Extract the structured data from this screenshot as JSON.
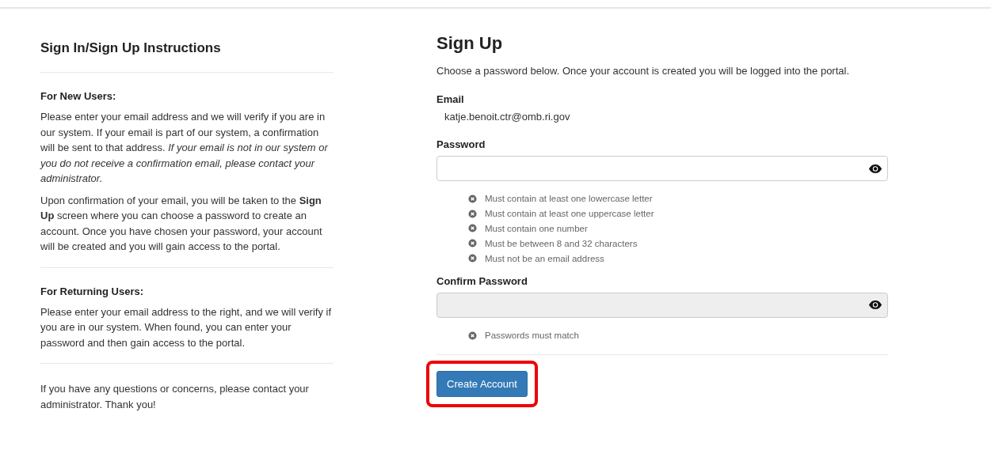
{
  "instructions": {
    "title": "Sign In/Sign Up Instructions",
    "sections": [
      {
        "heading": "For New Users:",
        "paragraphs": [
          "Please enter your email address and we will verify if you are in our system. If your email is part of our system, a confirmation will be sent to that address. *If your email is not in our system or you do not receive a confirmation email, please contact your administrator.*",
          "Upon confirmation of your email, you will be taken to the **Sign Up** screen where you can choose a password to create an account. Once you have chosen your password, your account will be created and you will gain access to the portal."
        ]
      },
      {
        "heading": "For Returning Users:",
        "paragraphs": [
          "Please enter your email address to the right, and we will verify if you are in our system. When found, you can enter your password and then gain access to the portal."
        ]
      },
      {
        "paragraphs": [
          "If you have any questions or concerns, please contact your administrator. Thank you!"
        ]
      }
    ]
  },
  "signup": {
    "title": "Sign Up",
    "intro": "Choose a password below. Once your account is created you will be logged into the portal.",
    "email": {
      "label": "Email",
      "value": "katje.benoit.ctr@omb.ri.gov"
    },
    "password": {
      "label": "Password",
      "disabled": false,
      "rules": [
        "Must contain at least one lowercase letter",
        "Must contain at least one uppercase letter",
        "Must contain one number",
        "Must be between 8 and 32 characters",
        "Must not be an email address"
      ]
    },
    "confirm_password": {
      "label": "Confirm Password",
      "disabled": true,
      "rules": [
        "Passwords must match"
      ]
    },
    "button": {
      "label": "Create Account",
      "highlighted": true
    }
  }
}
